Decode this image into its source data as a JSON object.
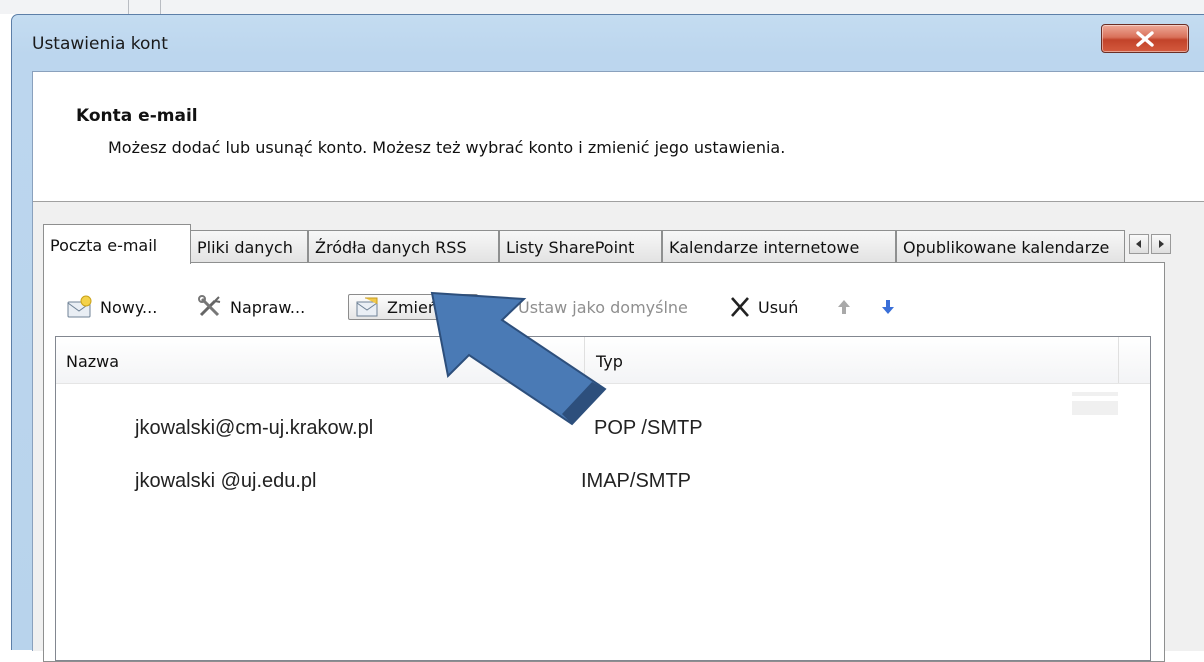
{
  "window": {
    "title": "Ustawienia kont"
  },
  "header": {
    "title": "Konta e-mail",
    "description": "Możesz dodać lub usunąć konto. Możesz też wybrać konto i zmienić jego ustawienia."
  },
  "tabs": [
    {
      "label": "Poczta e-mail",
      "active": true
    },
    {
      "label": "Pliki danych"
    },
    {
      "label": "Źródła danych RSS"
    },
    {
      "label": "Listy SharePoint"
    },
    {
      "label": "Kalendarze internetowe"
    },
    {
      "label": "Opublikowane kalendarze"
    }
  ],
  "toolbar": {
    "new_label": "Nowy...",
    "repair_label": "Napraw...",
    "change_label": "Zmień...",
    "set_default_label": "Ustaw jako domyślne",
    "delete_label": "Usuń"
  },
  "list": {
    "columns": [
      "Nazwa",
      "Typ"
    ],
    "rows": [
      {
        "name": "jkowalski@cm-uj.krakow.pl",
        "type": "POP /SMTP"
      },
      {
        "name": "jkowalski @uj.edu.pl",
        "type": "IMAP/SMTP"
      }
    ]
  },
  "colors": {
    "arrow": "#4a7ab5",
    "title_bar": "#bcd6ee",
    "close_button": "#c9523a"
  }
}
